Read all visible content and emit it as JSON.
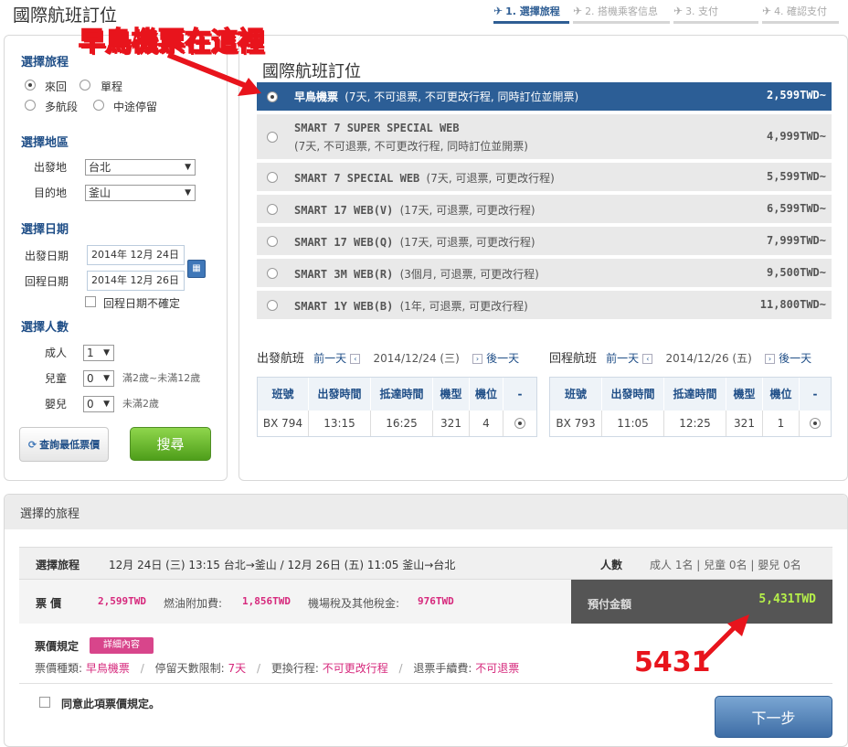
{
  "page_title": "國際航班訂位",
  "steps": [
    {
      "label": "1. 選擇旅程",
      "active": true
    },
    {
      "label": "2. 搭機乘客信息",
      "active": false
    },
    {
      "label": "3. 支付",
      "active": false
    },
    {
      "label": "4. 確認支付",
      "active": false
    }
  ],
  "annotations": {
    "top": "早鳥機票在這裡",
    "total": "5431"
  },
  "left": {
    "trip_title": "選擇旅程",
    "trip_options": [
      "來回",
      "單程",
      "多航段",
      "中途停留"
    ],
    "region_title": "選擇地區",
    "origin_label": "出發地",
    "origin_value": "台北",
    "dest_label": "目的地",
    "dest_value": "釜山",
    "date_title": "選擇日期",
    "depart_label": "出發日期",
    "depart_value": "2014年 12月 24日",
    "return_label": "回程日期",
    "return_value": "2014年 12月 26日",
    "uncertain_label": "回程日期不確定",
    "pax_title": "選擇人數",
    "adult_label": "成人",
    "adult_value": "1",
    "child_label": "兒童",
    "child_value": "0",
    "child_note": "滿2歲~未滿12歲",
    "infant_label": "嬰兒",
    "infant_value": "0",
    "infant_note": "未滿2歲",
    "lowest_button": "查詢最低票價",
    "search_button": "搜尋"
  },
  "main_title": "國際航班訂位",
  "fares": [
    {
      "name": "早鳥機票",
      "desc": "(7天, 不可退票, 不可更改行程, 同時訂位並開票)",
      "price": "2,599TWD~",
      "selected": true
    },
    {
      "name": "SMART 7 SUPER SPECIAL WEB",
      "desc": "(7天, 不可退票, 不可更改行程, 同時訂位並開票)",
      "price": "4,999TWD~",
      "selected": false
    },
    {
      "name": "SMART 7 SPECIAL WEB",
      "desc": "(7天, 可退票, 可更改行程)",
      "price": "5,599TWD~",
      "selected": false
    },
    {
      "name": "SMART 17 WEB(V)",
      "desc": "(17天, 可退票, 可更改行程)",
      "price": "6,599TWD~",
      "selected": false
    },
    {
      "name": "SMART 17 WEB(Q)",
      "desc": "(17天, 可退票, 可更改行程)",
      "price": "7,999TWD~",
      "selected": false
    },
    {
      "name": "SMART 3M WEB(R)",
      "desc": "(3個月, 可退票, 可更改行程)",
      "price": "9,500TWD~",
      "selected": false
    },
    {
      "name": "SMART 1Y WEB(B)",
      "desc": "(1年, 可退票, 可更改行程)",
      "price": "11,800TWD~",
      "selected": false
    }
  ],
  "outbound": {
    "heading": "出發航班",
    "prev": "前一天",
    "date": "2014/12/24 (三)",
    "next": "後一天",
    "columns": [
      "班號",
      "出發時間",
      "抵達時間",
      "機型",
      "機位",
      "-"
    ],
    "row": [
      "BX 794",
      "13:15",
      "16:25",
      "321",
      "4"
    ]
  },
  "inbound": {
    "heading": "回程航班",
    "prev": "前一天",
    "date": "2014/12/26 (五)",
    "next": "後一天",
    "columns": [
      "班號",
      "出發時間",
      "抵達時間",
      "機型",
      "機位",
      "-"
    ],
    "row": [
      "BX 793",
      "11:05",
      "12:25",
      "321",
      "1"
    ]
  },
  "summary": {
    "title": "選擇的旅程",
    "trip_label": "選擇旅程",
    "trip_text": "12月 24日 (三) 13:15 台北→釜山  / 12月 26日 (五) 11:05 釜山→台北",
    "pax_label": "人數",
    "pax_text": "成人 1名 | 兒童 0名 | 嬰兒 0名",
    "fare_label": "票 價",
    "fare_value": "2,599TWD",
    "fuel_label": "燃油附加費:",
    "fuel_value": "1,856TWD",
    "tax_label": "機場稅及其他稅金:",
    "tax_value": "976TWD",
    "pay_label": "預付金額",
    "pay_value": "5,431TWD",
    "rule_label": "票價規定",
    "detail_button": "詳細內容",
    "type_label": "票價種類:",
    "type_value": "早鳥機票",
    "stay_label": "停留天數限制:",
    "stay_value": "7天",
    "change_label": "更換行程:",
    "change_value": "不可更改行程",
    "refund_label": "退票手續費:",
    "refund_value": "不可退票",
    "agree_label": "同意此項票價規定。",
    "next_button": "下一步"
  }
}
